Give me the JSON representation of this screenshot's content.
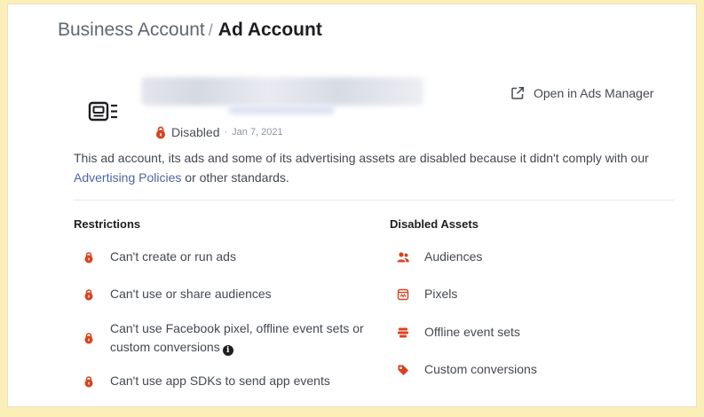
{
  "breadcrumb": {
    "parent": "Business Account",
    "separator": "/",
    "current": "Ad Account"
  },
  "account": {
    "icon": "ad-account-icon",
    "status_icon": "lock-icon",
    "status": "Disabled",
    "status_separator": "·",
    "date": "Jan 7, 2021"
  },
  "actions": {
    "open_ads_manager": "Open in Ads Manager",
    "open_icon": "external-link-icon"
  },
  "notice": {
    "text_before": "This ad account, its ads and some of its advertising assets are disabled because it didn't comply with our ",
    "link": "Advertising Policies",
    "text_after": " or other standards."
  },
  "restrictions": {
    "heading": "Restrictions",
    "items": [
      {
        "label": "Can't create or run ads",
        "icon": "lock-icon"
      },
      {
        "label": "Can't use or share audiences",
        "icon": "lock-icon"
      },
      {
        "label": "Can't use Facebook pixel, offline event sets or custom conversions",
        "icon": "lock-icon",
        "info_icon": "info-icon"
      },
      {
        "label": "Can't use app SDKs to send app events",
        "icon": "lock-icon"
      }
    ]
  },
  "disabled_assets": {
    "heading": "Disabled Assets",
    "items": [
      {
        "label": "Audiences",
        "icon": "people-icon"
      },
      {
        "label": "Pixels",
        "icon": "pixel-icon"
      },
      {
        "label": "Offline event sets",
        "icon": "offline-events-icon"
      },
      {
        "label": "Custom conversions",
        "icon": "tag-icon"
      }
    ]
  },
  "colors": {
    "accent_red": "#d8431f",
    "link_blue": "#4b66a3",
    "background_yellow": "#fbeeb6"
  }
}
